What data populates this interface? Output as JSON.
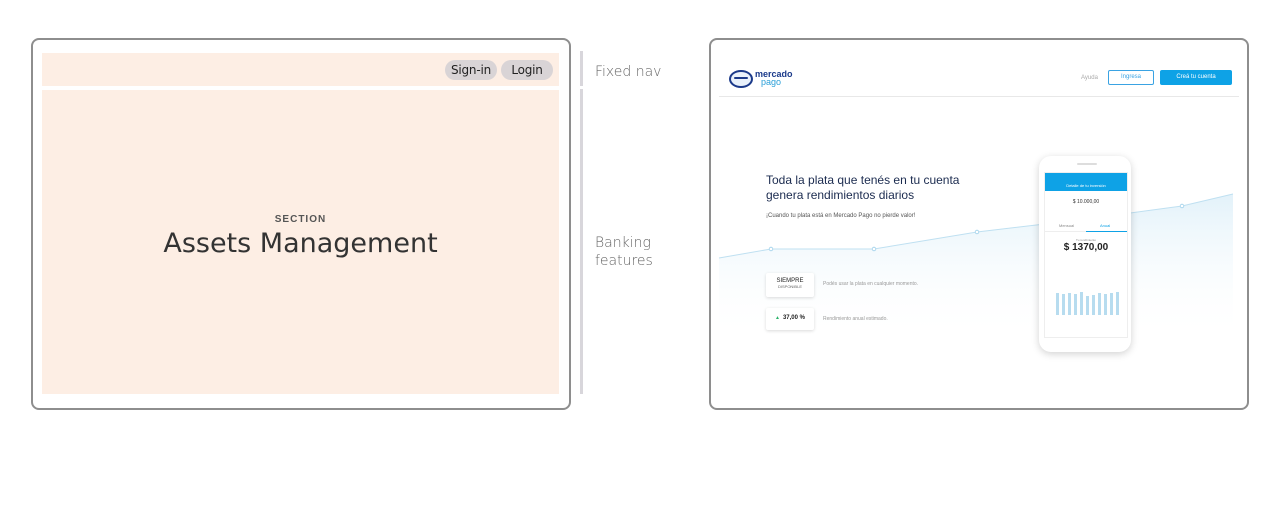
{
  "wireframe": {
    "nav": {
      "signin_label": "Sign-in",
      "login_label": "Login"
    },
    "section": {
      "eyebrow": "SECTION",
      "title": "Assets Management"
    }
  },
  "annotations": {
    "fixed_nav": "Fixed nav",
    "banking_features": "Banking features"
  },
  "mockup": {
    "logo": {
      "line1": "mercado",
      "line2": "pago"
    },
    "nav": {
      "help": "Ayuda",
      "login": "Ingresa",
      "signup": "Creá tu cuenta"
    },
    "headline": "Toda la plata que tenés en tu cuenta genera rendimientos diarios",
    "subheadline": "¡Cuando tu plata está en Mercado Pago no pierde valor!",
    "features": [
      {
        "title": "SIEMPRE",
        "subtitle": "DISPONIBLE",
        "description": "Podés usar la plata en cualquier momento."
      },
      {
        "title": "37,00 %",
        "description": "Rendimiento anual estimado."
      }
    ],
    "phone": {
      "bar_title": "Detalle de tu inversión",
      "top_amount": "$ 10.000,00",
      "tab_monthly": "Mensual",
      "tab_annual": "Anual",
      "earnings_label": "Tu rendimiento",
      "earnings_value": "$ 1370,00"
    },
    "colors": {
      "brand_blue": "#0ea2e6",
      "navy": "#1b3a8a",
      "positive": "#2db36a"
    }
  }
}
